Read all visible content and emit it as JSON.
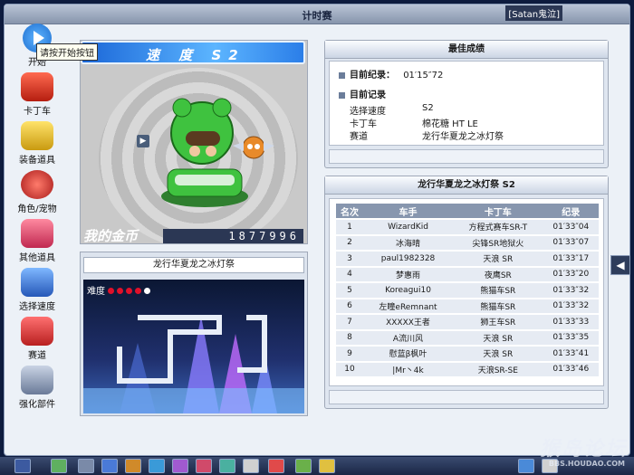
{
  "window": {
    "title": "计时赛",
    "user": "[Satan鬼泣]"
  },
  "tooltip": "请按开始按钮",
  "menu": [
    {
      "label": "开始",
      "icon": "play-icon",
      "color": "#1e7be0"
    },
    {
      "label": "卡丁车",
      "icon": "kart-icon",
      "color": "#e23a2a"
    },
    {
      "label": "装备道具",
      "icon": "goggles-icon",
      "color": "#f0c020"
    },
    {
      "label": "角色/宠物",
      "icon": "character-icon",
      "color": "#d03030"
    },
    {
      "label": "其他道具",
      "icon": "giftbox-icon",
      "color": "#e05070"
    },
    {
      "label": "选择速度",
      "icon": "speed-kart-icon",
      "color": "#3a7ad8"
    },
    {
      "label": "赛道",
      "icon": "track-flag-icon",
      "color": "#e04040"
    },
    {
      "label": "强化部件",
      "icon": "wrench-icon",
      "color": "#7a8aa8"
    }
  ],
  "speed_banner": "速 度 S2",
  "coins": {
    "label": "我的金币",
    "value": "1877996"
  },
  "track": {
    "name": "龙行华夏龙之冰灯祭",
    "difficulty_label": "难度",
    "difficulty_level": 4,
    "difficulty_max": 5
  },
  "best": {
    "header": "最佳成绩",
    "current_record_label": "目前纪录：",
    "current_record_value": "01′15″72",
    "my_record_label": "目前记录",
    "fields": [
      {
        "label": "选择速度",
        "value": "S2"
      },
      {
        "label": "卡丁车",
        "value": "棉花糖 HT LE"
      },
      {
        "label": "赛道",
        "value": "龙行华夏龙之冰灯祭"
      }
    ]
  },
  "ranking": {
    "header": "龙行华夏龙之冰灯祭 S2",
    "columns": [
      "名次",
      "车手",
      "卡丁车",
      "纪录"
    ],
    "rows": [
      [
        "1",
        "WizardKid",
        "方程式赛车SR-T",
        "01′33″04"
      ],
      [
        "2",
        "冰海晴",
        "尖锋SR地狱火",
        "01′33″07"
      ],
      [
        "3",
        "paul1982328",
        "天浪 SR",
        "01′33″17"
      ],
      [
        "4",
        "梦惠雨",
        "夜鹰SR",
        "01′33″20"
      ],
      [
        "5",
        "Koreagui10",
        "熊猫车SR",
        "01′33″32"
      ],
      [
        "6",
        "左瞳eRemnant",
        "熊猫车SR",
        "01′33″32"
      ],
      [
        "7",
        "XXXXX王者",
        "狮王车SR",
        "01′33″33"
      ],
      [
        "8",
        "A流川风",
        "天浪 SR",
        "01′33″35"
      ],
      [
        "9",
        "慰蓝β枫叶",
        "天浪 SR",
        "01′33″41"
      ],
      [
        "10",
        "|Mr丶4k",
        "天浪SR-SE",
        "01′33″46"
      ]
    ]
  },
  "watermark": {
    "main": "猴岛论坛",
    "sub": "BBS.HOUDAO.COM"
  }
}
